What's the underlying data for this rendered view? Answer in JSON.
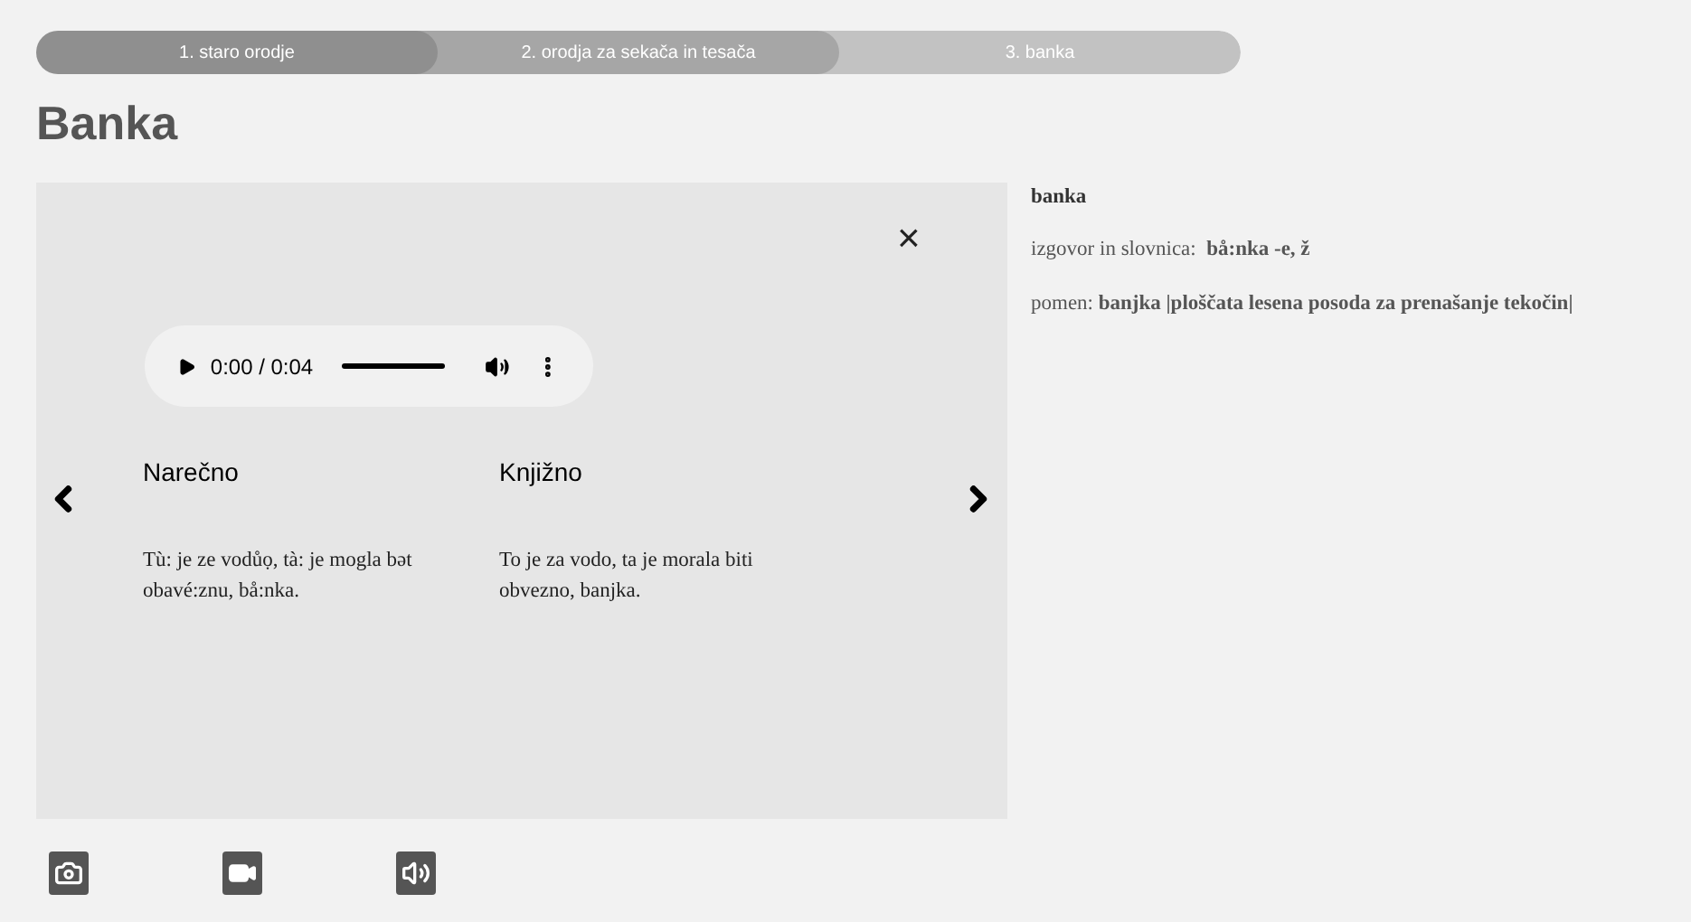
{
  "steps": [
    {
      "label": "1. staro orodje",
      "color": "#8f8f8f"
    },
    {
      "label": "2. orodja za sekača in tesača",
      "color": "#a6a6a6"
    },
    {
      "label": "3. banka",
      "color": "#c2c2c2"
    }
  ],
  "title": "Banka",
  "card": {
    "close": "×",
    "player": {
      "time": "0:00 / 0:04"
    },
    "columns": [
      {
        "heading": "Narečno",
        "text": "Tù: je ze vodůọ, tà: je mogla bət obavé:znu, bå:nka."
      },
      {
        "heading": "Knjižno",
        "text": "To je za vodo, ta je morala biti obvezno, banjka."
      }
    ]
  },
  "entry": {
    "word": "banka",
    "lines": [
      "izgovor in slovnica:  **bå:nka -e, ž**",
      "pomen: **banjka |ploščata lesena posoda za prenašanje tekočin|**"
    ]
  },
  "media_buttons": [
    {
      "kind": "photo"
    },
    {
      "kind": "video"
    },
    {
      "kind": "audio"
    }
  ]
}
